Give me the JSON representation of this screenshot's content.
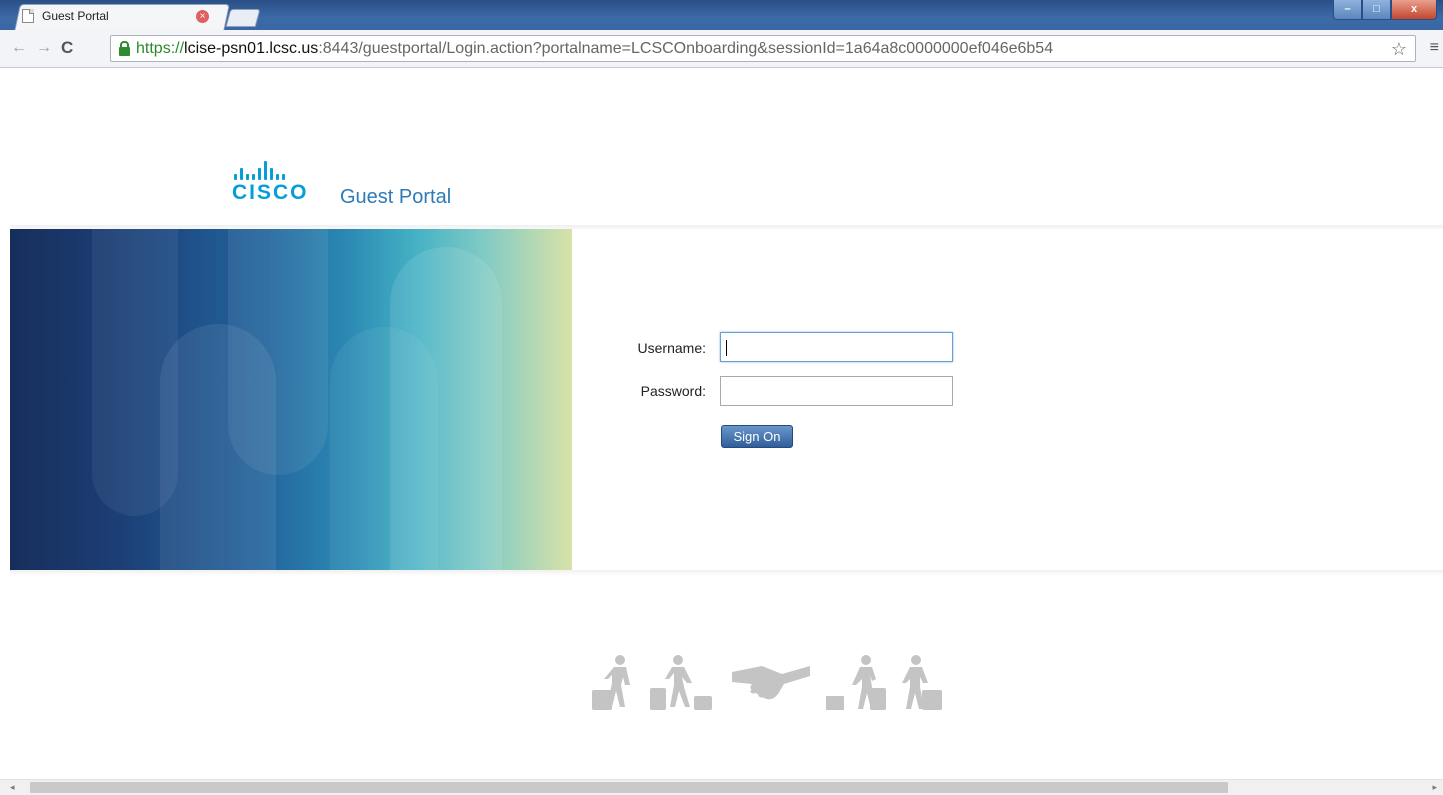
{
  "browser": {
    "tab_title": "Guest Portal",
    "tab_close": "×",
    "window_buttons": {
      "minimize": "–",
      "restore": "□",
      "close": "x"
    },
    "nav": {
      "back": "←",
      "forward": "→",
      "reload": "C"
    },
    "url": {
      "https": "https://",
      "host": "lcise-psn01.lcsc.us",
      "rest": ":8443/guestportal/Login.action?portalname=LCSCOnboarding&sessionId=1a64a8c0000000ef046e6b54"
    },
    "bookmark_icon": "star-icon",
    "menu_icon": "hamburger-menu-icon"
  },
  "page": {
    "logo_text": "CISCO",
    "portal_title": "Guest Portal",
    "form": {
      "username_label": "Username:",
      "username_value": "",
      "password_label": "Password:",
      "password_value": "",
      "submit_label": "Sign On"
    },
    "illustration": "guest-people-handshake-icon"
  },
  "colors": {
    "cisco_blue": "#049fd9",
    "portal_title": "#2d7bb8",
    "button": "#2f5f9b"
  }
}
